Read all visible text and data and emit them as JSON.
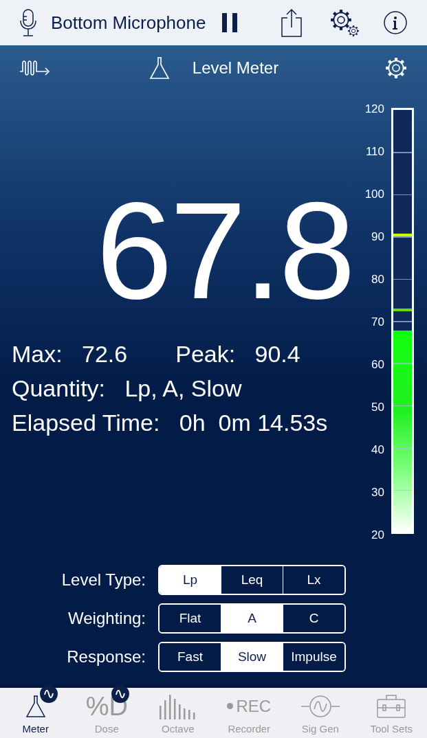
{
  "top_bar": {
    "source": "Bottom Microphone"
  },
  "header": {
    "title": "Level Meter"
  },
  "reading": "67.8",
  "stats": [
    {
      "label": "Max:",
      "value": "72.6"
    },
    {
      "label": "Peak:",
      "value": "90.4"
    }
  ],
  "quantity": {
    "label": "Quantity:",
    "value": "Lp, A, Slow"
  },
  "elapsed": {
    "label": "Elapsed Time:",
    "value": "0h  0m 14.53s"
  },
  "meter": {
    "ticks": [
      "120",
      "110",
      "100",
      "90",
      "80",
      "70",
      "60",
      "50",
      "40",
      "30",
      "20"
    ],
    "level": 0.478,
    "markers": [
      {
        "kind": "peak",
        "level": 0.704
      },
      {
        "kind": "max",
        "level": 0.526
      }
    ]
  },
  "controls": [
    {
      "label": "Level Type:",
      "options": [
        {
          "label": "Lp",
          "selected": true
        },
        {
          "label": "Leq",
          "selected": false
        },
        {
          "label": "Lx",
          "selected": false
        }
      ]
    },
    {
      "label": "Weighting:",
      "options": [
        {
          "label": "Flat",
          "selected": false
        },
        {
          "label": "A",
          "selected": true
        },
        {
          "label": "C",
          "selected": false
        }
      ]
    },
    {
      "label": "Response:",
      "options": [
        {
          "label": "Fast",
          "selected": false
        },
        {
          "label": "Slow",
          "selected": true
        },
        {
          "label": "Impulse",
          "selected": false
        }
      ]
    }
  ],
  "tabs": [
    {
      "kind": "flask",
      "label": "Meter",
      "selected": true,
      "badge": true
    },
    {
      "kind": "dose",
      "glyph": "%D",
      "label": "Dose",
      "selected": false,
      "badge": true
    },
    {
      "kind": "octave",
      "label": "Octave",
      "selected": false,
      "badge": false
    },
    {
      "kind": "rec",
      "glyph": "REC",
      "label": "Recorder",
      "selected": false,
      "badge": false
    },
    {
      "kind": "siggen",
      "label": "Sig Gen",
      "selected": false,
      "badge": false
    },
    {
      "kind": "toolbox",
      "label": "Tool Sets",
      "selected": false,
      "badge": false
    }
  ]
}
